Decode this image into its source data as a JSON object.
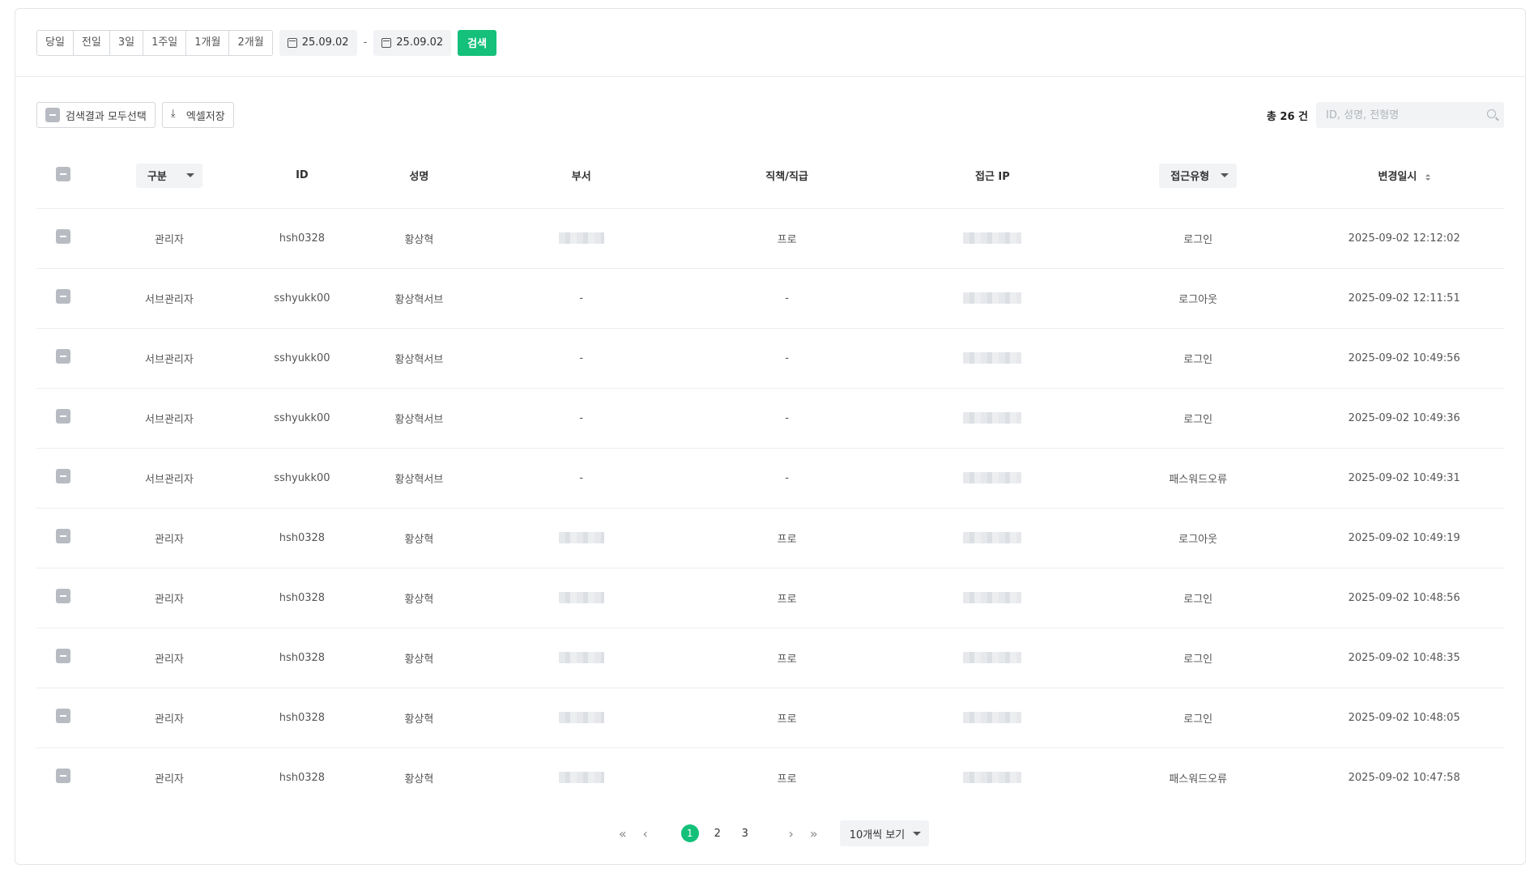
{
  "filters": {
    "periods": [
      "당일",
      "전일",
      "3일",
      "1주일",
      "1개월",
      "2개월"
    ],
    "date_from": "25.09.02",
    "date_sep": "-",
    "date_to": "25.09.02",
    "search_label": "검색"
  },
  "toolbar": {
    "select_all_label": "검색결과 모두선택",
    "excel_label": "엑셀저장",
    "total_label": "총 26 건",
    "search_placeholder": "ID, 성명, 전형명"
  },
  "table": {
    "headers": {
      "type": "구분",
      "id": "ID",
      "name": "성명",
      "dept": "부서",
      "position": "직책/직급",
      "ip": "접근 IP",
      "access_type": "접근유형",
      "changed_at": "변경일시"
    },
    "rows": [
      {
        "type": "관리자",
        "id": "hsh0328",
        "name": "황상혁",
        "dept_masked": true,
        "dept": "",
        "position": "프로",
        "access": "로그인",
        "changed_at": "2025-09-02 12:12:02"
      },
      {
        "type": "서브관리자",
        "id": "sshyukk00",
        "name": "황상혁서브",
        "dept_masked": false,
        "dept": "-",
        "position": "-",
        "access": "로그아웃",
        "changed_at": "2025-09-02 12:11:51"
      },
      {
        "type": "서브관리자",
        "id": "sshyukk00",
        "name": "황상혁서브",
        "dept_masked": false,
        "dept": "-",
        "position": "-",
        "access": "로그인",
        "changed_at": "2025-09-02 10:49:56"
      },
      {
        "type": "서브관리자",
        "id": "sshyukk00",
        "name": "황상혁서브",
        "dept_masked": false,
        "dept": "-",
        "position": "-",
        "access": "로그인",
        "changed_at": "2025-09-02 10:49:36"
      },
      {
        "type": "서브관리자",
        "id": "sshyukk00",
        "name": "황상혁서브",
        "dept_masked": false,
        "dept": "-",
        "position": "-",
        "access": "패스워드오류",
        "changed_at": "2025-09-02 10:49:31"
      },
      {
        "type": "관리자",
        "id": "hsh0328",
        "name": "황상혁",
        "dept_masked": true,
        "dept": "",
        "position": "프로",
        "access": "로그아웃",
        "changed_at": "2025-09-02 10:49:19"
      },
      {
        "type": "관리자",
        "id": "hsh0328",
        "name": "황상혁",
        "dept_masked": true,
        "dept": "",
        "position": "프로",
        "access": "로그인",
        "changed_at": "2025-09-02 10:48:56"
      },
      {
        "type": "관리자",
        "id": "hsh0328",
        "name": "황상혁",
        "dept_masked": true,
        "dept": "",
        "position": "프로",
        "access": "로그인",
        "changed_at": "2025-09-02 10:48:35"
      },
      {
        "type": "관리자",
        "id": "hsh0328",
        "name": "황상혁",
        "dept_masked": true,
        "dept": "",
        "position": "프로",
        "access": "로그인",
        "changed_at": "2025-09-02 10:48:05"
      },
      {
        "type": "관리자",
        "id": "hsh0328",
        "name": "황상혁",
        "dept_masked": true,
        "dept": "",
        "position": "프로",
        "access": "패스워드오류",
        "changed_at": "2025-09-02 10:47:58"
      }
    ]
  },
  "pagination": {
    "pages": [
      "1",
      "2",
      "3"
    ],
    "current": "1",
    "page_size_label": "10개씩 보기"
  },
  "colors": {
    "accent": "#14c07a"
  }
}
